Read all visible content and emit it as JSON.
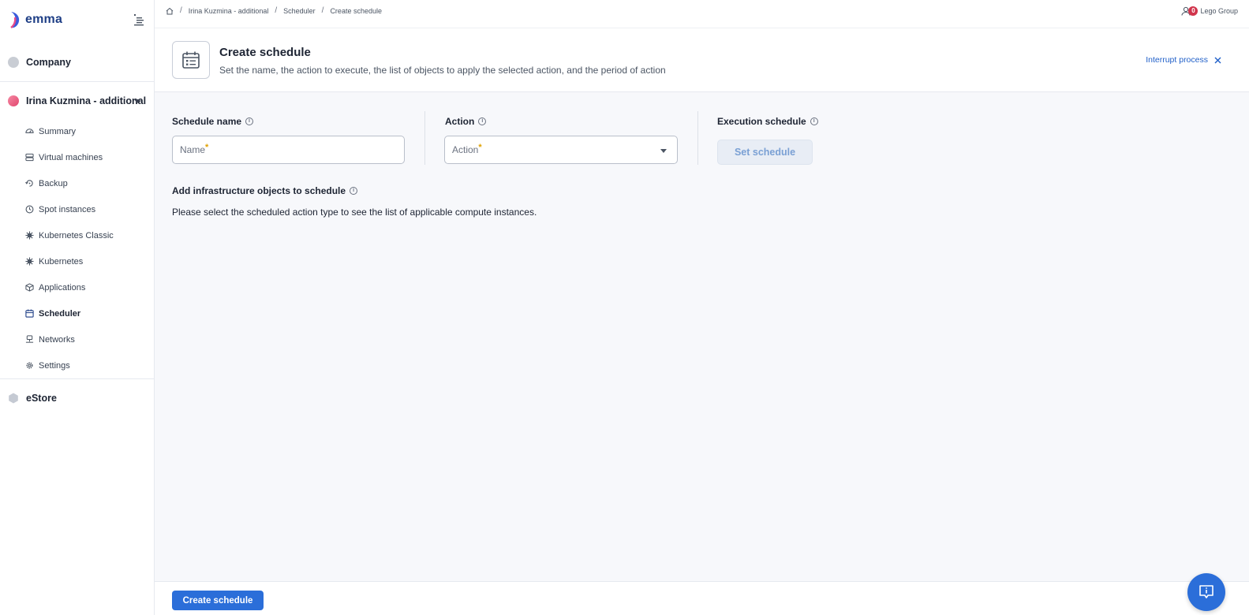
{
  "app": {
    "name": "emma"
  },
  "sidebar": {
    "sections": [
      {
        "label": "Company"
      },
      {
        "label": "Irina Kuzmina - additional"
      },
      {
        "label": "eStore"
      }
    ],
    "items": [
      {
        "label": "Summary",
        "icon": "dashboard-icon"
      },
      {
        "label": "Virtual machines",
        "icon": "server-icon"
      },
      {
        "label": "Backup",
        "icon": "backup-icon"
      },
      {
        "label": "Spot instances",
        "icon": "clock-icon"
      },
      {
        "label": "Kubernetes Classic",
        "icon": "kubernetes-icon"
      },
      {
        "label": "Kubernetes",
        "icon": "kubernetes-icon"
      },
      {
        "label": "Applications",
        "icon": "cube-icon"
      },
      {
        "label": "Scheduler",
        "icon": "calendar-icon",
        "active": true
      },
      {
        "label": "Networks",
        "icon": "network-icon"
      },
      {
        "label": "Settings",
        "icon": "gear-icon"
      }
    ]
  },
  "breadcrumb": [
    "Irina Kuzmina - additional",
    "Scheduler",
    "Create schedule"
  ],
  "user": {
    "notification_count": "0",
    "org": "Lego Group"
  },
  "header": {
    "title": "Create schedule",
    "subtitle": "Set the name, the action to execute, the list of objects to apply the selected action, and the period of action",
    "interrupt": "Interrupt process"
  },
  "form": {
    "schedule_name_label": "Schedule name",
    "name_placeholder": "Name",
    "action_label": "Action",
    "action_placeholder": "Action",
    "execution_label": "Execution schedule",
    "set_schedule": "Set schedule",
    "objects_label": "Add infrastructure objects to schedule",
    "objects_hint": "Please select the scheduled action type to see the list of applicable compute instances.",
    "required_mark": "*",
    "info_glyph": "i"
  },
  "footer": {
    "create_button": "Create schedule"
  },
  "colors": {
    "accent": "#2b6ed9",
    "link": "#2261c9",
    "badge": "#d1344c",
    "required": "#e0a100"
  }
}
